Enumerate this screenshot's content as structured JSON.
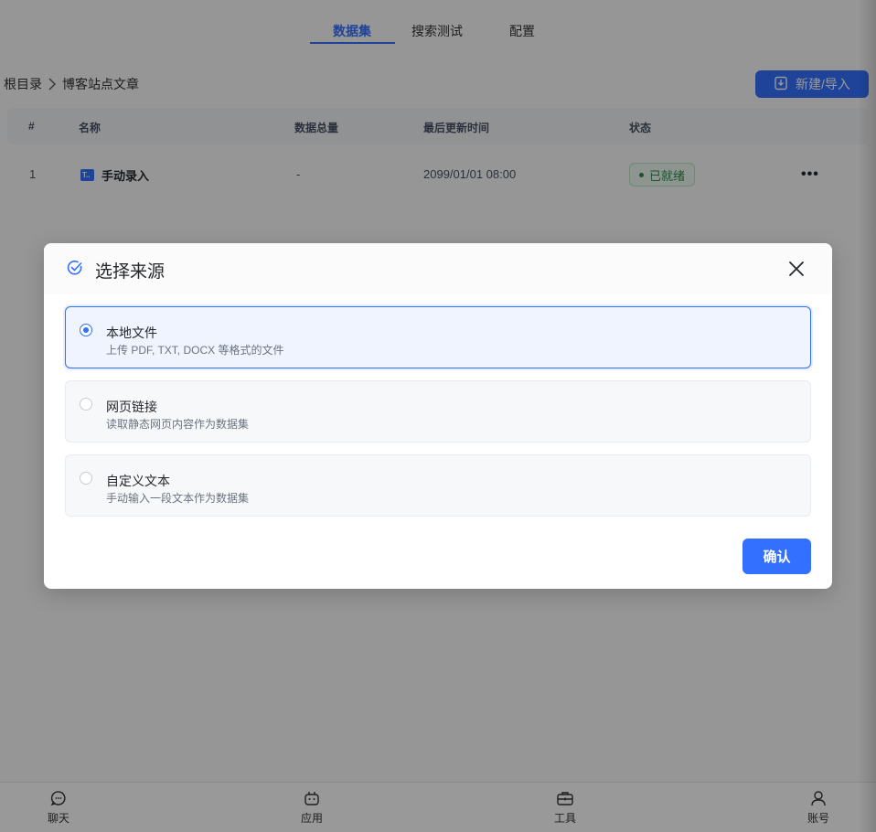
{
  "tabs": [
    {
      "label": "数据集",
      "active": true
    },
    {
      "label": "搜索测试",
      "active": false
    },
    {
      "label": "配置",
      "active": false
    }
  ],
  "breadcrumb": [
    "根目录",
    "博客站点文章"
  ],
  "new_import_button": "新建/导入",
  "table": {
    "headers": [
      "#",
      "名称",
      "数据总量",
      "最后更新时间",
      "状态"
    ],
    "rows": [
      {
        "index": "1",
        "icon_text": "T..",
        "name": "手动录入",
        "total": "-",
        "updated": "2099/01/01 08:00",
        "status": "已就绪",
        "more": "•••"
      }
    ]
  },
  "bottom_nav": [
    {
      "label": "聊天",
      "icon": "chat-icon"
    },
    {
      "label": "应用",
      "icon": "robot-icon"
    },
    {
      "label": "工具",
      "icon": "toolbox-icon"
    },
    {
      "label": "账号",
      "icon": "user-icon"
    }
  ],
  "modal": {
    "title": "选择来源",
    "options": [
      {
        "title": "本地文件",
        "desc": "上传 PDF, TXT, DOCX 等格式的文件",
        "selected": true
      },
      {
        "title": "网页链接",
        "desc": "读取静态网页内容作为数据集",
        "selected": false
      },
      {
        "title": "自定义文本",
        "desc": "手动输入一段文本作为数据集",
        "selected": false
      }
    ],
    "confirm_label": "确认"
  },
  "colors": {
    "accent": "#3370ff",
    "status_ready": "#2b8a4f",
    "overlay": "rgba(0,0,0,0.40)"
  }
}
